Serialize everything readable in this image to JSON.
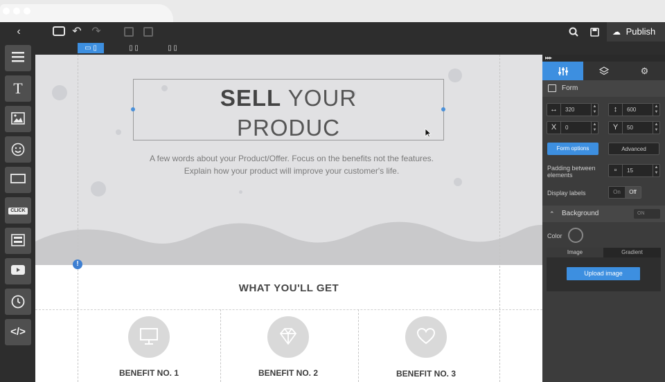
{
  "toolbar": {
    "publish_label": "Publish"
  },
  "canvas": {
    "hero_title_bold": "SELL",
    "hero_title_rest": " YOUR",
    "hero_title_line2": "PRODUC",
    "hero_subtitle_line1": "A few words about your Product/Offer. Focus on the benefits not the features.",
    "hero_subtitle_line2": "Explain how your product will improve your customer's life.",
    "section_title": "WHAT YOU'LL GET",
    "benefits": [
      {
        "label": "BENEFIT NO. 1",
        "icon": "monitor-icon"
      },
      {
        "label": "BENEFIT NO. 2",
        "icon": "diamond-icon"
      },
      {
        "label": "BENEFIT NO. 3",
        "icon": "heart-icon"
      }
    ],
    "alert_glyph": "!"
  },
  "sidebar": {
    "click_label": "CLICK"
  },
  "panel": {
    "form_title": "Form",
    "width_value": "320",
    "height_value": "600",
    "x_label": "X",
    "x_value": "0",
    "y_label": "Y",
    "y_value": "50",
    "form_options_label": "Form options",
    "advanced_label": "Advanced",
    "padding_label": "Padding between elements",
    "padding_value": "15",
    "display_labels_label": "Display labels",
    "toggle_on": "On",
    "toggle_off": "Off",
    "background_title": "Background",
    "background_toggle": "ON",
    "color_label": "Color",
    "image_tab": "Image",
    "gradient_tab": "Gradient",
    "upload_label": "Upload image"
  },
  "colors": {
    "accent": "#3d8fe0",
    "toolbar": "#2d2d2d",
    "panel": "#3c3c3c"
  }
}
